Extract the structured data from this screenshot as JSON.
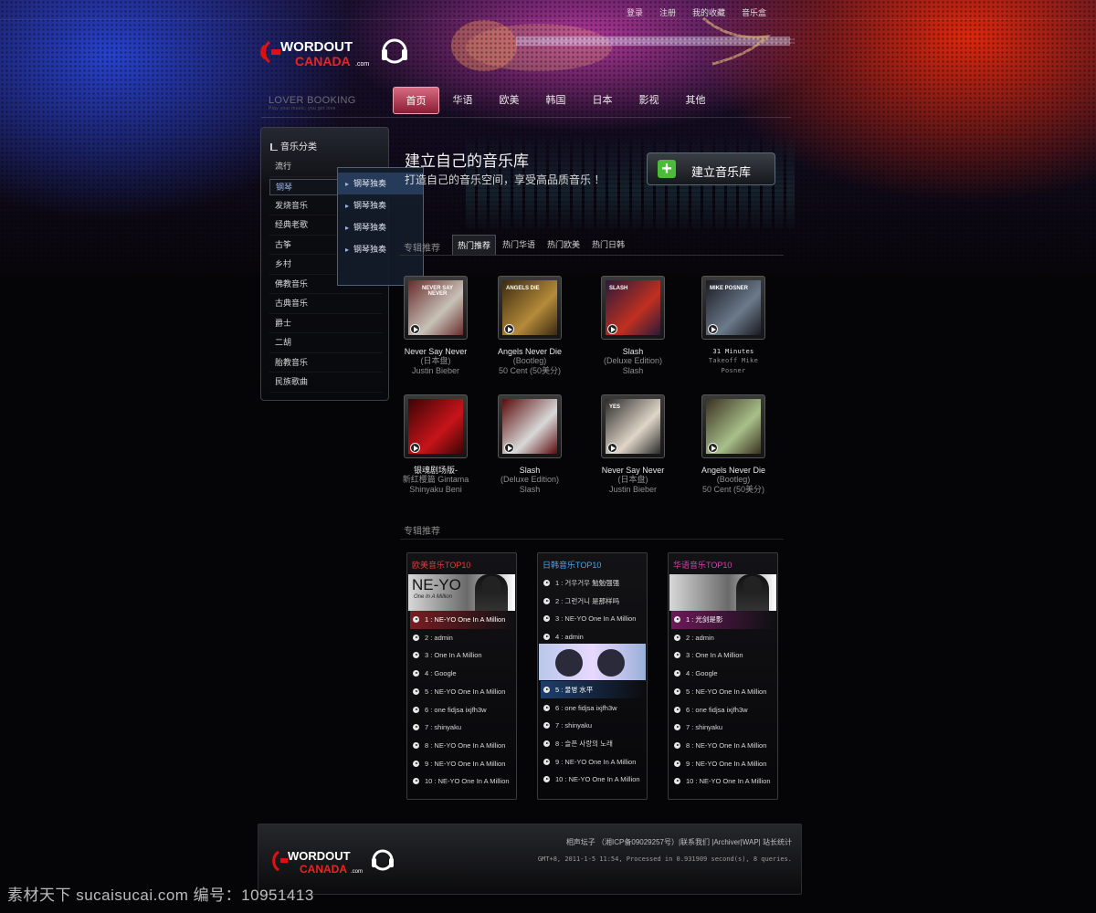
{
  "top_links": [
    "登录",
    "注册",
    "我的收藏",
    "音乐盒"
  ],
  "brand": {
    "line1": "WORDOUT",
    "line2": "CANADA",
    "suffix": ".com"
  },
  "nav": {
    "tagline": "LOVER BOOKING",
    "tagline_small": "Play your music, you get love",
    "items": [
      "首页",
      "华语",
      "欧美",
      "韩国",
      "日本",
      "影视",
      "其他"
    ],
    "active_index": 0
  },
  "sidebar": {
    "title": "音乐分类",
    "items": [
      "流行",
      "钢琴",
      "发烧音乐",
      "经典老歌",
      "古筝",
      "乡村",
      "佛教音乐",
      "古典音乐",
      "爵士",
      "二胡",
      "胎教音乐",
      "民族歌曲"
    ],
    "selected_index": 1,
    "submenu": [
      "钢琴独奏",
      "钢琴独奏",
      "钢琴独奏",
      "钢琴独奏"
    ]
  },
  "hero": {
    "title": "建立自己的音乐库",
    "subtitle": "打造自己的音乐空间，享受高品质音乐 ！",
    "button": "建立音乐库"
  },
  "tabs": {
    "section_label": "专辑推荐",
    "items": [
      "热门推荐",
      "热门华语",
      "热门欧美",
      "热门日韩"
    ],
    "active_index": 0
  },
  "albums": [
    {
      "l1": "Never Say Never",
      "l2": "(日本盘)",
      "l3": "Justin Bieber",
      "mono": false,
      "palette": [
        "#6a2a2a",
        "#c7c2b8"
      ],
      "cover_text": "NEVER SAY NEVER"
    },
    {
      "l1": "Angels Never Die",
      "l2": "(Bootleg)",
      "l3": "50 Cent (50美分)",
      "mono": false,
      "palette": [
        "#3a2a10",
        "#b58a3a"
      ],
      "cover_text": "ANGELS DIE"
    },
    {
      "l1": "Slash",
      "l2": "(Deluxe Edition)",
      "l3": "Slash",
      "mono": false,
      "palette": [
        "#2a1a3a",
        "#c03020"
      ],
      "cover_text": "SLASH"
    },
    {
      "l1": "31 Minutes",
      "l2": "Takeoff Mike",
      "l3": "Posner",
      "mono": true,
      "palette": [
        "#1a1a22",
        "#6b7a8a"
      ],
      "cover_text": "MIKE POSNER"
    },
    {
      "l1": "银魂剧场版-",
      "l2": "新红樱篇 Gintama",
      "l3": "Shinyaku Beni",
      "mono": false,
      "palette": [
        "#3a0505",
        "#c8141a"
      ],
      "cover_text": ""
    },
    {
      "l1": "Slash",
      "l2": "(Deluxe Edition)",
      "l3": "Slash",
      "mono": false,
      "palette": [
        "#5a0a0a",
        "#d9d9d9"
      ],
      "cover_text": ""
    },
    {
      "l1": "Never Say Never",
      "l2": "(日本盘)",
      "l3": "Justin Bieber",
      "mono": false,
      "palette": [
        "#2a2a2a",
        "#e0d6c8"
      ],
      "cover_text": "YES"
    },
    {
      "l1": "Angels Never Die",
      "l2": "(Bootleg)",
      "l3": "50 Cent (50美分)",
      "mono": false,
      "palette": [
        "#3a3020",
        "#a8c08a"
      ],
      "cover_text": ""
    }
  ],
  "charts_section_label": "专辑推荐",
  "charts": [
    {
      "title": "欧美音乐TOP10",
      "title_color": "#e03a3a",
      "highlight_color": "#7a1d22",
      "banner_text": "NE-YO",
      "banner_sub": "One In A Million",
      "banner_after": 0,
      "rows": [
        "1 : NE-YO  One In A Million",
        "2 : admin",
        "3 : One In A Million",
        "4 : Google",
        "5 : NE-YO  One In A Million",
        "6 : one fidjsa ixjfh3w",
        "7 : shinyaku",
        "8 : NE-YO  One In A Million",
        "9 : NE-YO  One In A Million",
        "10 : NE-YO  One In A Million"
      ],
      "highlight": 0
    },
    {
      "title": "日韩音乐TOP10",
      "title_color": "#4aa3e8",
      "highlight_color": "#1d3f6e",
      "banner_text": "",
      "banner_sub": "",
      "banner_after": 4,
      "rows": [
        "1 : 거우거우 勉勉强强",
        "2 : 그런거니 是那样吗",
        "3 : NE-YO  One In A Million",
        "4 : admin",
        "5 : 물병 水平",
        "6 : one fidjsa ixjfh3w",
        "7 : shinyaku",
        "8 : 슬픈 사랑의 노래",
        "9 : NE-YO  One In A Million",
        "10 : NE-YO  One In A Million"
      ],
      "highlight": 4
    },
    {
      "title": "华语音乐TOP10",
      "title_color": "#d040a8",
      "highlight_color": "#6d1a5a",
      "banner_text": "",
      "banner_sub": "",
      "banner_after": 0,
      "rows": [
        "1 : 光剑是影",
        "2 : admin",
        "3 : One In A Million",
        "4 : Google",
        "5 : NE-YO  One In A Million",
        "6 : one fidjsa ixjfh3w",
        "7 : shinyaku",
        "8 : NE-YO  One In A Million",
        "9 : NE-YO  One In A Million",
        "10 : NE-YO  One In A Million"
      ],
      "highlight": 0
    }
  ],
  "footer": {
    "line1": "相声坛子 （湘ICP备09029257号）|联系我们 |Archiver|WAP| 站长统计",
    "line2": "GMT+8, 2011-1-5 11:54, Processed in 0.931909 second(s), 8 queries."
  },
  "watermark": "素材天下 sucaisucai.com  编号：10951413",
  "colors": {
    "nav_active": "#b0304f",
    "create_plus": "#4cbb3a"
  }
}
